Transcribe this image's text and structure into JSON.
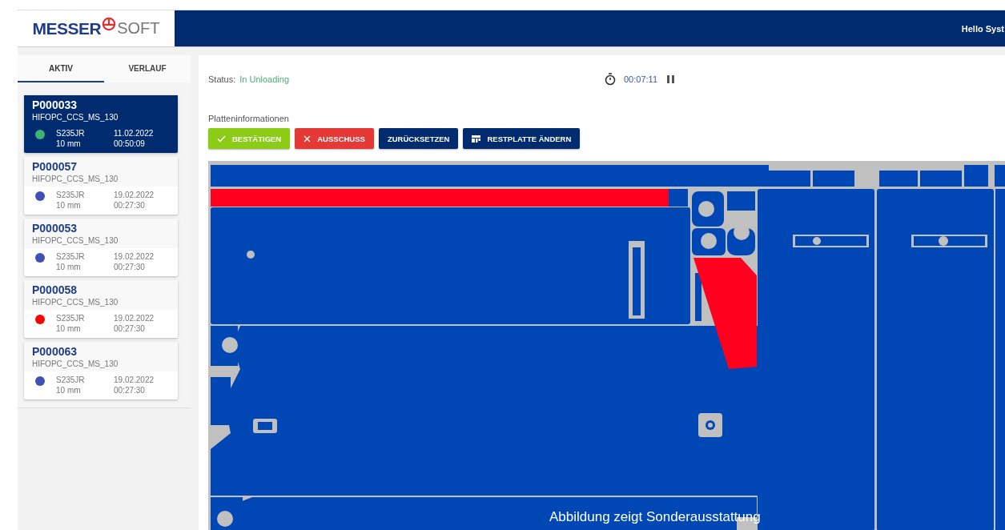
{
  "header": {
    "logo_word_1": "MESSER",
    "logo_word_2": "SOFT",
    "greeting": "Hello Syst"
  },
  "tabs": [
    {
      "label": "AKTIV",
      "selected": true
    },
    {
      "label": "VERLAUF",
      "selected": false
    }
  ],
  "plates": [
    {
      "id": "P000033",
      "program": "HIFOPC_CCS_MS_130",
      "color": "#3cb371",
      "material": "S235JR",
      "thickness": "10 mm",
      "date": "11.02.2022",
      "time": "00:50:09",
      "selected": true
    },
    {
      "id": "P000057",
      "program": "HIFOPC_CCS_MS_130",
      "color": "#3f51b5",
      "material": "S235JR",
      "thickness": "10 mm",
      "date": "19.02.2022",
      "time": "00:27:30",
      "selected": false
    },
    {
      "id": "P000053",
      "program": "HIFOPC_CCS_MS_130",
      "color": "#3f51b5",
      "material": "S235JR",
      "thickness": "10 mm",
      "date": "19.02.2022",
      "time": "00:27:30",
      "selected": false
    },
    {
      "id": "P000058",
      "program": "HIFOPC_CCS_MS_130",
      "color": "#ff0000",
      "material": "S235JR",
      "thickness": "10 mm",
      "date": "19.02.2022",
      "time": "00:27:30",
      "selected": false
    },
    {
      "id": "P000063",
      "program": "HIFOPC_CCS_MS_130",
      "color": "#3f51b5",
      "material": "S235JR",
      "thickness": "10 mm",
      "date": "19.02.2022",
      "time": "00:27:30",
      "selected": false
    }
  ],
  "status": {
    "label": "Status:",
    "value": "In Unloading"
  },
  "timer": {
    "value": "00:07:11"
  },
  "section_title": "Platteninformationen",
  "actions": [
    {
      "label": "BESTÄTIGEN",
      "kind": "confirm"
    },
    {
      "label": "AUSSCHUSS",
      "kind": "reject"
    },
    {
      "label": "ZURÜCKSETZEN",
      "kind": "plain"
    },
    {
      "label": "RESTPLATTE ÄNDERN",
      "kind": "remnant"
    }
  ],
  "caption": "Abbildung zeigt Sonderausstattung"
}
